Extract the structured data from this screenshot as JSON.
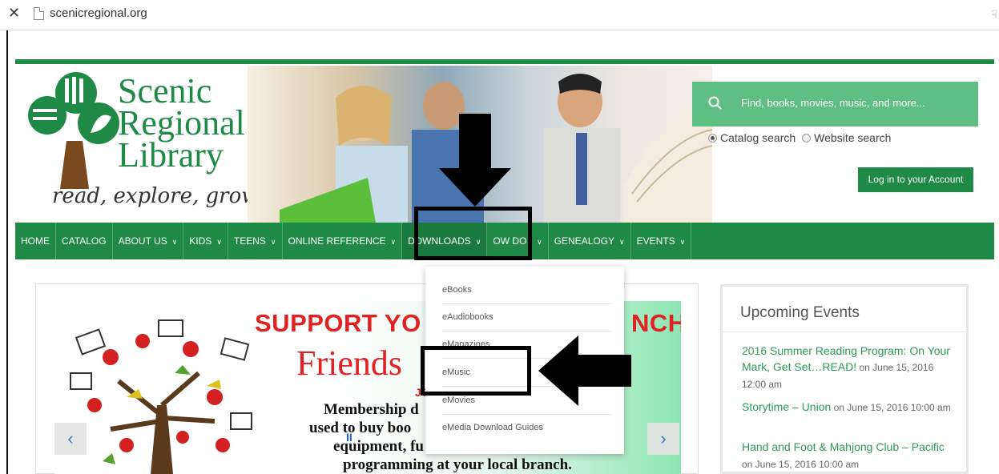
{
  "browser": {
    "close_glyph": "✕",
    "url": "scenicregional.org",
    "corner_glyph": "☟"
  },
  "logo": {
    "name_line1": "Scenic",
    "name_line2": "Regional",
    "name_line3": "Library",
    "tagline": "read, explore, grow"
  },
  "search": {
    "placeholder": "Find, books, movies, music, and more...",
    "option_catalog": "Catalog search",
    "option_website": "Website search",
    "selected": "Catalog search"
  },
  "account": {
    "login_label": "Log in to your Account"
  },
  "nav": {
    "items": [
      {
        "label": "HOME",
        "chevron": ""
      },
      {
        "label": "CATALOG",
        "chevron": ""
      },
      {
        "label": "ABOUT US",
        "chevron": "∨"
      },
      {
        "label": "KIDS",
        "chevron": "∨"
      },
      {
        "label": "TEENS",
        "chevron": "∨"
      },
      {
        "label": "ONLINE REFERENCE",
        "chevron": "∨"
      },
      {
        "label": "DOWNLOADS",
        "chevron": "∨"
      },
      {
        "label": "OW DO I",
        "chevron": "∨"
      },
      {
        "label": "GENEALOGY",
        "chevron": "∨"
      },
      {
        "label": "EVENTS",
        "chevron": "∨"
      }
    ]
  },
  "downloads_menu": {
    "items": [
      "eBooks",
      "eAudiobooks",
      "eMagazines",
      "eMusic",
      "eMovies",
      "eMedia Download Guides"
    ]
  },
  "slider": {
    "headline": "SUPPORT YO",
    "headline_end": "NCH",
    "friends": "Friends",
    "join": "JO",
    "line1": "Membership d",
    "line2": "used to buy boo",
    "line3": "equipment, fu",
    "line4": "programming at your local branch.",
    "prev_glyph": "‹",
    "next_glyph": "›",
    "pause_glyph": "II"
  },
  "events": {
    "title": "Upcoming Events",
    "items": [
      {
        "name": "2016 Summer Reading Program: On Your Mark, Get Set…READ!",
        "when": " on June 15, 2016 12:00 am"
      },
      {
        "name": "Storytime – Union",
        "when": " on June 15, 2016 10:00 am"
      },
      {
        "name": "Hand and Foot & Mahjong Club – Pacific",
        "when": " on June 15, 2016 10:00 am"
      }
    ]
  },
  "colors": {
    "brand_green": "#1e8a45",
    "search_green": "#5fbf82",
    "headline_red": "#e02222"
  }
}
